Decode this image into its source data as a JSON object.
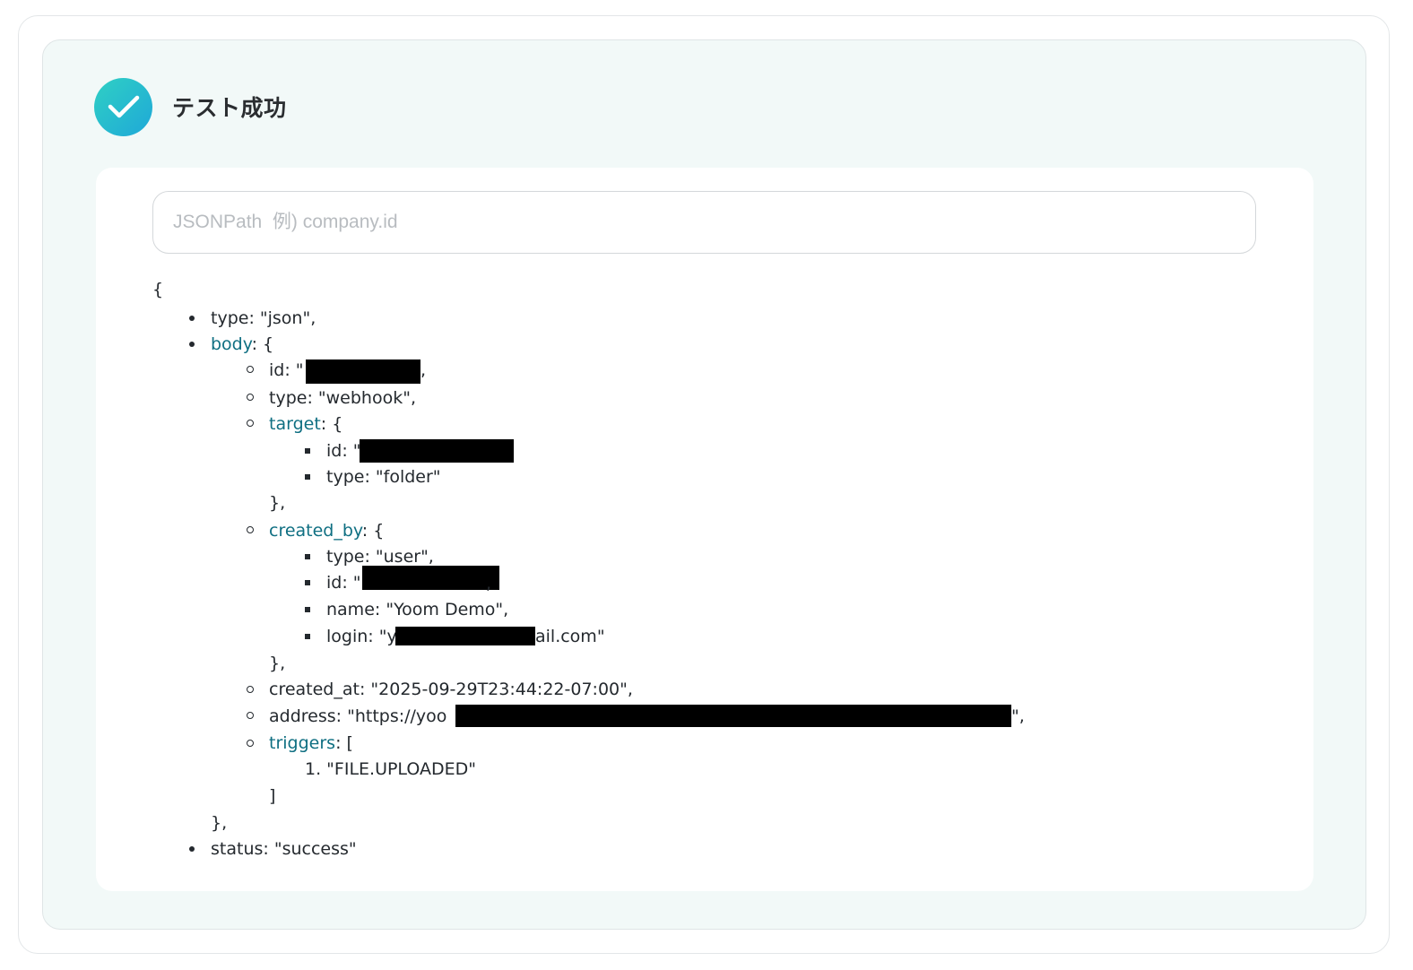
{
  "header": {
    "title": "テスト成功",
    "status_icon": "check-icon",
    "accent_color": "#22c0d0"
  },
  "search": {
    "placeholder": "JSONPath  例) company.id",
    "value": ""
  },
  "json_tree": {
    "open_brace": "{",
    "type_line": "type: \"json\",",
    "body_key": "body",
    "body_open": ": {",
    "body_id_prefix": "id: \"",
    "body_id_suffix": ",",
    "body_type_line": "type: \"webhook\",",
    "target_key": "target",
    "target_open": ": {",
    "target_id_prefix": "id: \"",
    "target_type_line": "type: \"folder\"",
    "target_close": "},",
    "created_by_key": "created_by",
    "created_by_open": ": {",
    "cb_type_line": "type: \"user\",",
    "cb_id_prefix": "id: \"",
    "cb_id_suffix": ",",
    "cb_name_line": "name: \"Yoom Demo\",",
    "cb_login_prefix": "login: \"y",
    "cb_login_suffix": "ail.com\"",
    "created_by_close": "},",
    "created_at_line": "created_at: \"2025-09-29T23:44:22-07:00\",",
    "address_prefix": "address: \"https://yoo",
    "address_suffix": "\",",
    "triggers_key": "triggers",
    "triggers_open": ": [",
    "trigger_item": "1. \"FILE.UPLOADED\"",
    "triggers_close": "]",
    "body_close": "},",
    "status_line": "status: \"success\""
  }
}
